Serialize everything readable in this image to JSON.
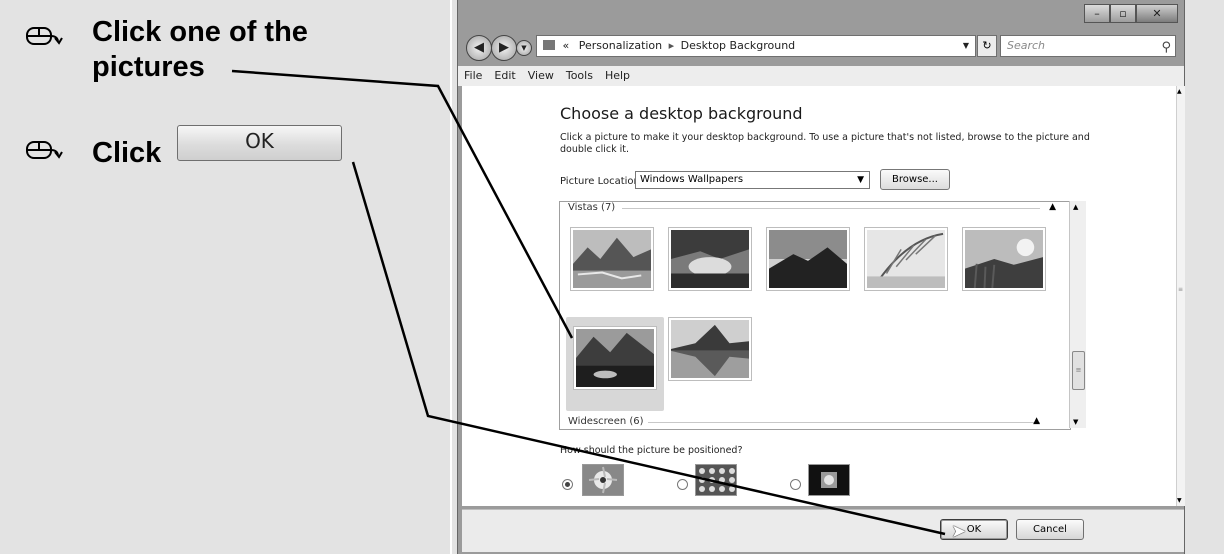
{
  "instructions": {
    "step1_line1": "Click one of the",
    "step1_line2": "pictures",
    "step2_prefix": "Click",
    "step2_button": "OK"
  },
  "window": {
    "address": {
      "chevron": "«",
      "crumb1": "Personalization",
      "crumb2": "Desktop Background"
    },
    "search_placeholder": "Search",
    "menu": [
      "File",
      "Edit",
      "View",
      "Tools",
      "Help"
    ],
    "heading": "Choose a desktop background",
    "description": "Click a picture to make it your desktop background. To use a picture that's not listed, browse to the picture and double click it.",
    "location_label": "Picture Location",
    "location_value": "Windows Wallpapers",
    "browse_label": "Browse...",
    "group_vistas": "Vistas (7)",
    "group_widescreen": "Widescreen (6)",
    "position_question": "How should the picture be positioned?",
    "ok_label": "OK",
    "cancel_label": "Cancel",
    "position_options": [
      "fit-to-screen",
      "tile",
      "center"
    ],
    "selected_position": "fit-to-screen"
  },
  "icons": {
    "mouse": "mouse-icon",
    "back": "back-arrow-icon",
    "forward": "forward-arrow-icon",
    "search": "search-icon"
  },
  "colors": {
    "page_bg": "#e3e3e3",
    "window_frame": "#9b9b9b"
  }
}
